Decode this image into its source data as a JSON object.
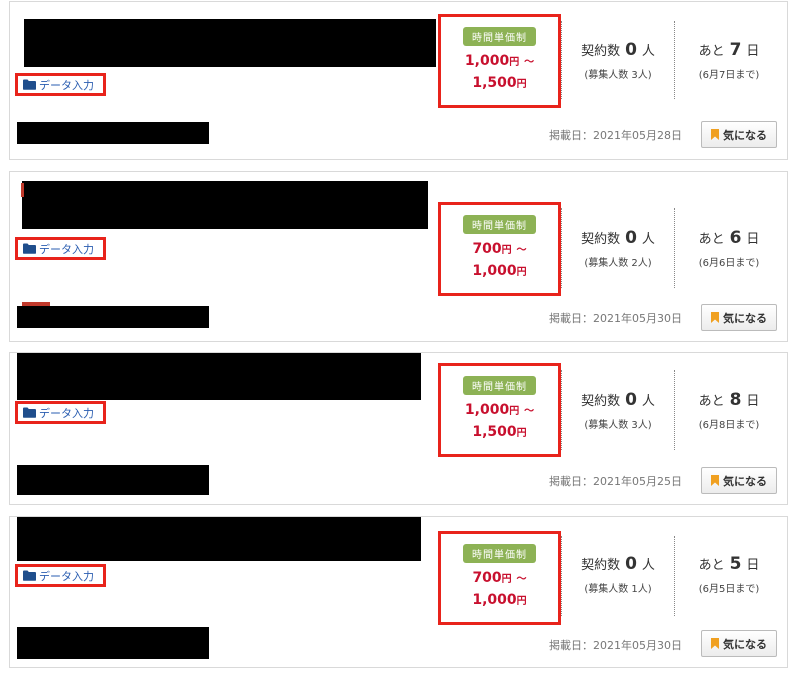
{
  "colors": {
    "highlight_border": "#e8231b",
    "price_text": "#c8102e",
    "wage_badge_bg": "#8db255",
    "category_link": "#2a5db0",
    "bookmark_icon": "#f0a020",
    "folder_icon": "#1f4e8c"
  },
  "jobs": [
    {
      "category": "データ入力",
      "category_icon": "folder-icon",
      "wage_type": "時間単価制",
      "price_min": "1,000",
      "price_max": "1,500",
      "price_unit": "円",
      "price_sep": "～",
      "contracts_label": "契約数",
      "contracts_count": "0",
      "contracts_unit": "人",
      "recruit_text": "(募集人数 3人)",
      "remain_label": "あと",
      "remain_days": "7",
      "remain_unit": "日",
      "deadline_text": "(6月7日まで)",
      "posted_date": "掲載日：2021年05月28日",
      "favorite_label": "気になる",
      "favorite_icon": "bookmark-icon"
    },
    {
      "category": "データ入力",
      "category_icon": "folder-icon",
      "wage_type": "時間単価制",
      "price_min": "700",
      "price_max": "1,000",
      "price_unit": "円",
      "price_sep": "～",
      "contracts_label": "契約数",
      "contracts_count": "0",
      "contracts_unit": "人",
      "recruit_text": "(募集人数 2人)",
      "remain_label": "あと",
      "remain_days": "6",
      "remain_unit": "日",
      "deadline_text": "(6月6日まで)",
      "posted_date": "掲載日：2021年05月30日",
      "favorite_label": "気になる",
      "favorite_icon": "bookmark-icon"
    },
    {
      "category": "データ入力",
      "category_icon": "folder-icon",
      "wage_type": "時間単価制",
      "price_min": "1,000",
      "price_max": "1,500",
      "price_unit": "円",
      "price_sep": "～",
      "contracts_label": "契約数",
      "contracts_count": "0",
      "contracts_unit": "人",
      "recruit_text": "(募集人数 3人)",
      "remain_label": "あと",
      "remain_days": "8",
      "remain_unit": "日",
      "deadline_text": "(6月8日まで)",
      "posted_date": "掲載日：2021年05月25日",
      "favorite_label": "気になる",
      "favorite_icon": "bookmark-icon"
    },
    {
      "category": "データ入力",
      "category_icon": "folder-icon",
      "wage_type": "時間単価制",
      "price_min": "700",
      "price_max": "1,000",
      "price_unit": "円",
      "price_sep": "～",
      "contracts_label": "契約数",
      "contracts_count": "0",
      "contracts_unit": "人",
      "recruit_text": "(募集人数 1人)",
      "remain_label": "あと",
      "remain_days": "5",
      "remain_unit": "日",
      "deadline_text": "(6月5日まで)",
      "posted_date": "掲載日：2021年05月30日",
      "favorite_label": "気になる",
      "favorite_icon": "bookmark-icon"
    }
  ]
}
